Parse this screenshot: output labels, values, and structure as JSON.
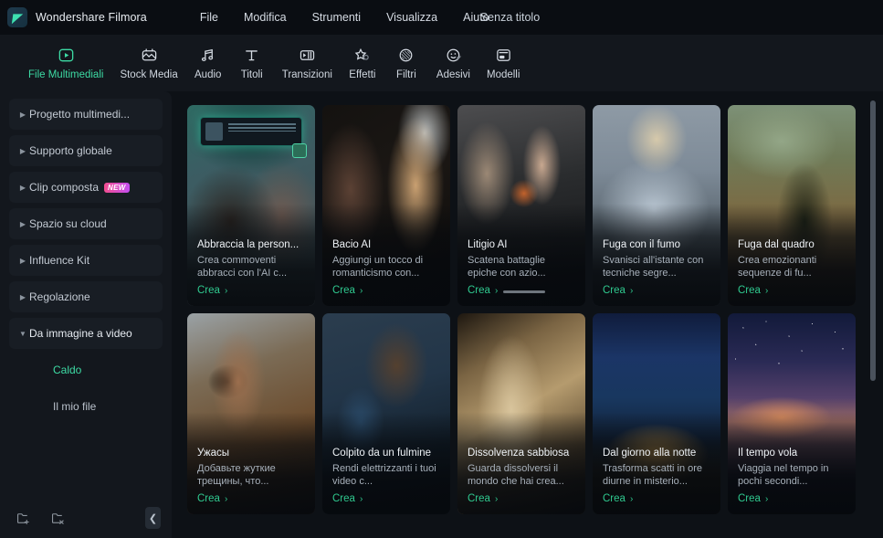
{
  "titlebar": {
    "app_name": "Wondershare Filmora",
    "logo_icon": "filmora-logo-icon",
    "document_title": "Senza titolo",
    "menus": [
      {
        "label": "File"
      },
      {
        "label": "Modifica"
      },
      {
        "label": "Strumenti"
      },
      {
        "label": "Visualizza"
      },
      {
        "label": "Aiuto"
      }
    ]
  },
  "toolbar": {
    "active_index": 0,
    "items": [
      {
        "label": "File Multimediali",
        "icon": "media-play-frame-icon"
      },
      {
        "label": "Stock Media",
        "icon": "stock-media-icon"
      },
      {
        "label": "Audio",
        "icon": "music-note-icon"
      },
      {
        "label": "Titoli",
        "icon": "text-title-icon"
      },
      {
        "label": "Transizioni",
        "icon": "transition-icon"
      },
      {
        "label": "Effetti",
        "icon": "effects-star-icon"
      },
      {
        "label": "Filtri",
        "icon": "filter-circle-icon"
      },
      {
        "label": "Adesivi",
        "icon": "sticker-smiley-icon"
      },
      {
        "label": "Modelli",
        "icon": "templates-icon"
      }
    ]
  },
  "sidebar": {
    "items": [
      {
        "label": "Progetto multimedi...",
        "expanded": false,
        "badge": null
      },
      {
        "label": "Supporto globale",
        "expanded": false,
        "badge": null
      },
      {
        "label": "Clip composta",
        "expanded": false,
        "badge": "NEW"
      },
      {
        "label": "Spazio su cloud",
        "expanded": false,
        "badge": null
      },
      {
        "label": "Influence Kit",
        "expanded": false,
        "badge": null
      },
      {
        "label": "Regolazione",
        "expanded": false,
        "badge": null
      },
      {
        "label": "Da immagine a video",
        "expanded": true,
        "badge": null
      }
    ],
    "sub_items": [
      {
        "label": "Caldo",
        "selected": true
      },
      {
        "label": "Il mio file",
        "selected": false
      }
    ],
    "footer": {
      "new_folder_icon": "folder-add-icon",
      "delete_folder_icon": "folder-remove-icon",
      "collapse_icon": "chevron-left-icon"
    }
  },
  "content": {
    "cta_label": "Crea",
    "cta_chevron": "›",
    "cards": [
      {
        "title": "Abbraccia la person...",
        "desc": "Crea commoventi abbracci con l'AI c...",
        "art": "art-hug",
        "progress": false
      },
      {
        "title": "Bacio AI",
        "desc": "Aggiungi un tocco di romanticismo con...",
        "art": "art-kiss",
        "progress": false
      },
      {
        "title": "Litigio AI",
        "desc": "Scatena battaglie epiche con azio...",
        "art": "art-fight",
        "progress": true
      },
      {
        "title": "Fuga con il fumo",
        "desc": "Svanisci all'istante con tecniche segre...",
        "art": "art-smoke",
        "progress": false
      },
      {
        "title": "Fuga dal quadro",
        "desc": "Crea emozionanti sequenze di fu...",
        "art": "art-paint",
        "progress": false
      },
      {
        "title": "Ужасы",
        "desc": "Добавьте жуткие трещины, что...",
        "art": "art-horror",
        "progress": false
      },
      {
        "title": "Colpito da un fulmine",
        "desc": "Rendi elettrizzanti i tuoi video c...",
        "art": "art-bolt",
        "progress": false
      },
      {
        "title": "Dissolvenza sabbiosa",
        "desc": "Guarda dissolversi il mondo che hai crea...",
        "art": "art-sand",
        "progress": false
      },
      {
        "title": "Dal giorno alla notte",
        "desc": "Trasforma scatti in ore diurne in misterio...",
        "art": "art-night",
        "progress": false
      },
      {
        "title": "Il tempo vola",
        "desc": "Viaggia nel tempo in pochi secondi...",
        "art": "art-time",
        "progress": false
      }
    ]
  },
  "colors": {
    "accent_green": "#3ddba4",
    "cta_green": "#2fc98f",
    "window_bg": "#0a0d12",
    "panel_bg": "#13171d",
    "content_bg": "#0d1116",
    "badge_gradient_start": "#f24e8f",
    "badge_gradient_end": "#c44ef2"
  }
}
